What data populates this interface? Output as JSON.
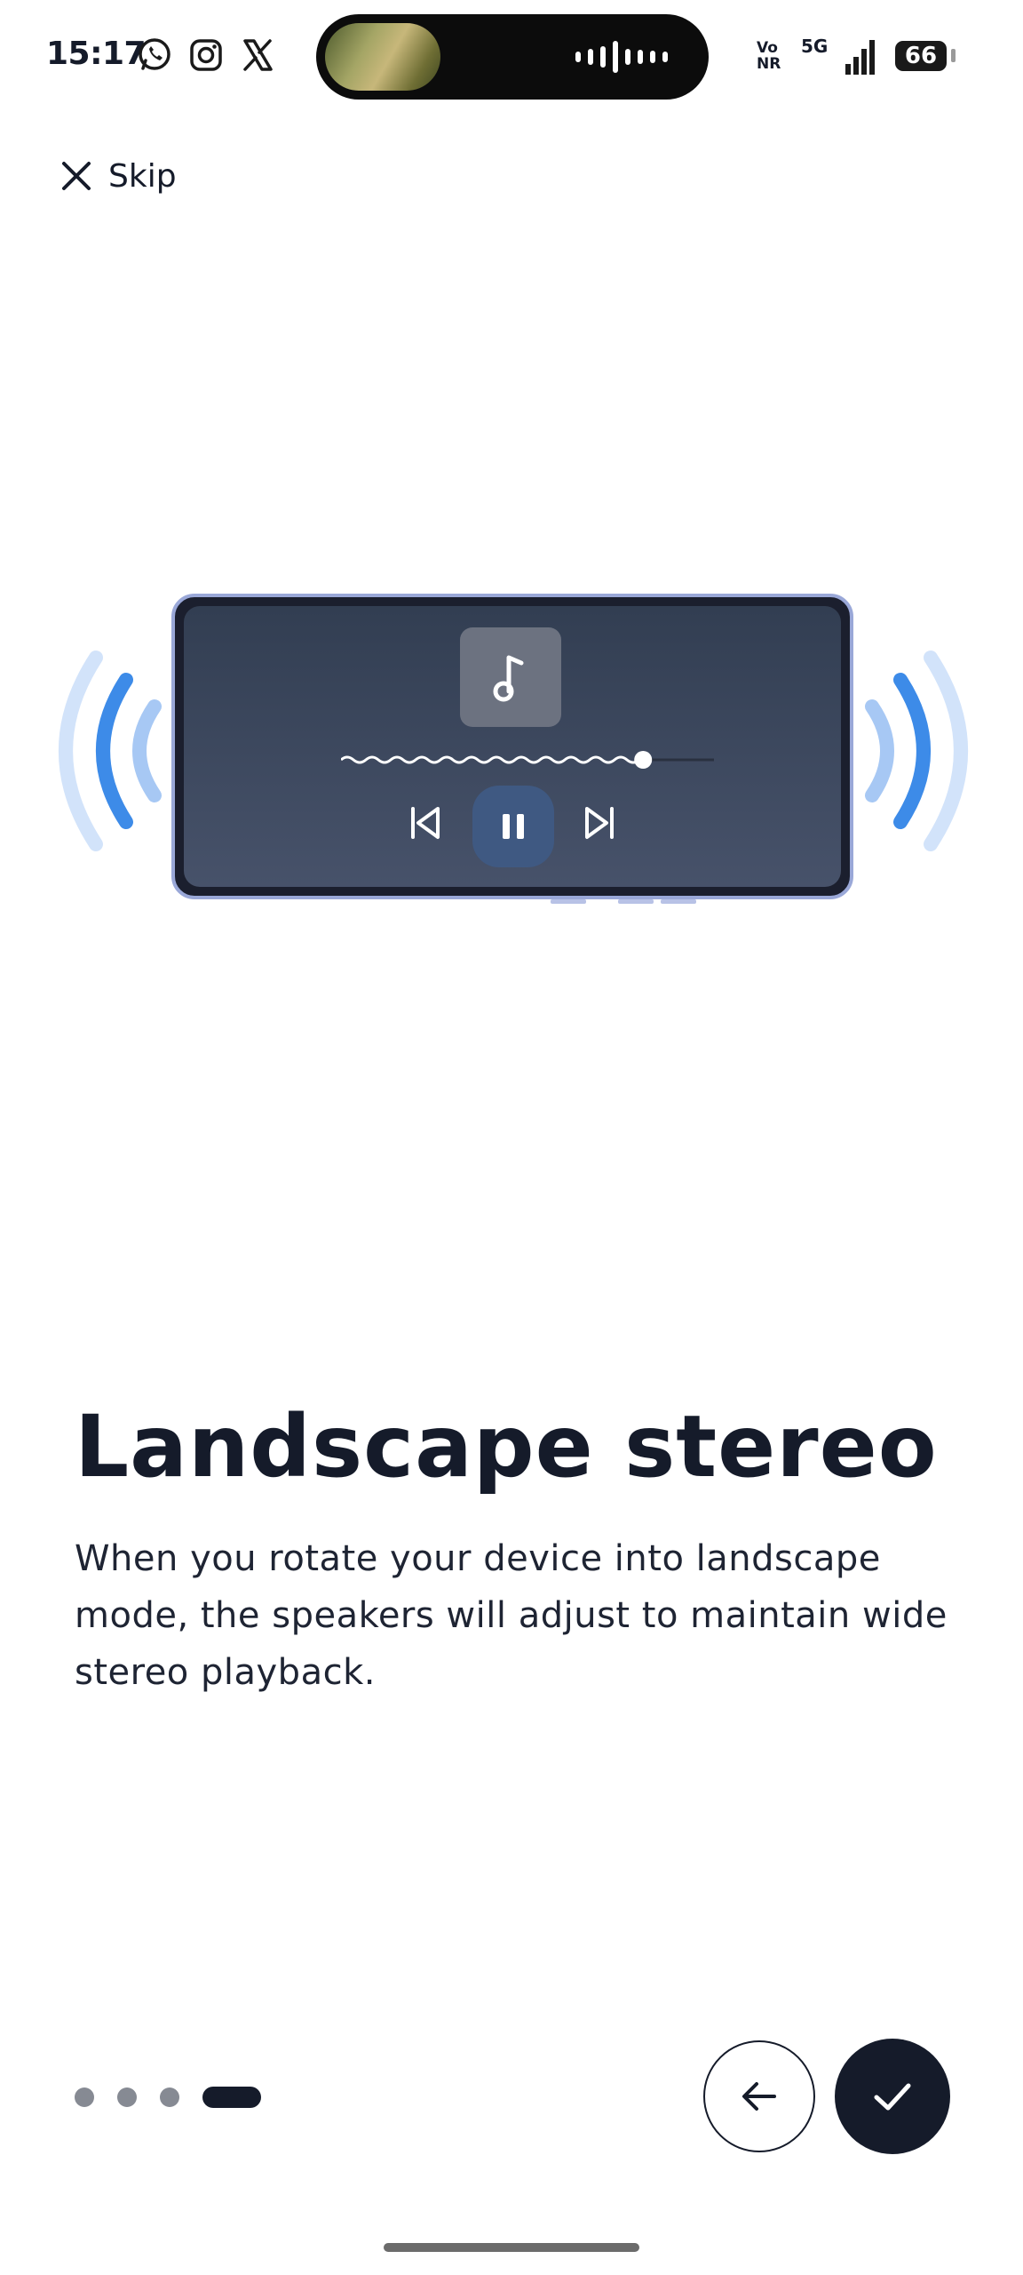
{
  "status_bar": {
    "time": "15:17",
    "network_top": "Vo",
    "network_bottom": "NR",
    "network_5g": "5G",
    "battery": "66",
    "app_icons": [
      "whatsapp-icon",
      "instagram-icon",
      "x-icon"
    ]
  },
  "header": {
    "skip_label": "Skip"
  },
  "illustration": {
    "progress_fraction": 0.81
  },
  "content": {
    "title": "Landscape stereo",
    "description": "When you rotate your device into landscape mode, the speakers will adjust to maintain wide stereo playback."
  },
  "pager": {
    "total": 4,
    "active_index": 3
  },
  "colors": {
    "dark": "#151b2a",
    "wave_strong": "#3d8be8",
    "wave_light": "#a7c8f4",
    "wave_pale": "#d2e3fa"
  }
}
